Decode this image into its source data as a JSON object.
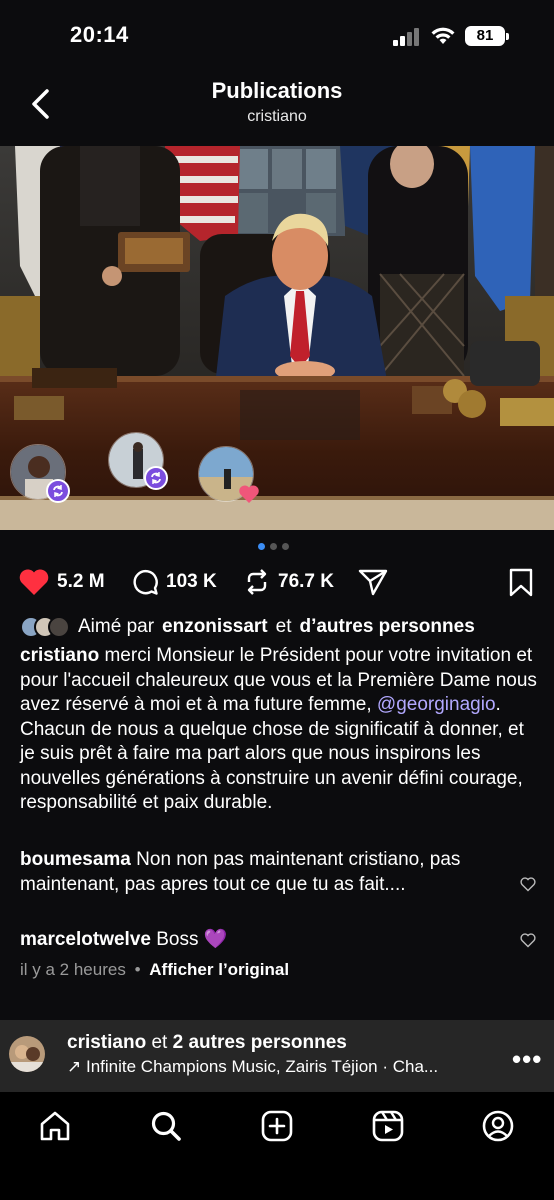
{
  "status_bar": {
    "time": "20:14",
    "battery": "81"
  },
  "header": {
    "title": "Publications",
    "subtitle": "cristiano"
  },
  "post": {
    "carousel_count": 3,
    "carousel_active": 1,
    "likes": "5.2 M",
    "comments": "103 K",
    "reposts": "76.7 K",
    "liked_by_prefix": "Aimé par",
    "liked_by_user": "enzonissart",
    "liked_by_conj": "et",
    "liked_by_rest": "d’autres personnes",
    "caption_user": "cristiano",
    "caption_text_1": " merci Monsieur le Président pour votre invitation et pour l'accueil chaleureux que vous et la Première Dame nous avez réservé à moi et à ma future femme, ",
    "caption_mention": "@georginagio",
    "caption_text_2": ". Chacun de nous a quelque chose de significatif à donner, et je suis prêt à faire ma part alors que nous inspirons les nouvelles générations à construire un avenir défini courage, responsabilité et paix durable.",
    "comments_list": [
      {
        "user": "boumesama",
        "text": " Non non pas maintenant cristiano, pas maintenant, pas apres tout ce que tu as fait...."
      },
      {
        "user": "marcelotwelve",
        "text": " Boss 💜"
      }
    ],
    "time_ago": "il y a 2 heures",
    "separator": "•",
    "translate_link": "Afficher l’original"
  },
  "music": {
    "user": "cristiano",
    "conj": "et",
    "others": "2 autres personnes",
    "arrow": "↗",
    "track": "Infinite Champions Music, Zairis Téjion · Cha...",
    "more": "•••"
  },
  "colors": {
    "like_red": "#ff3040",
    "mention": "#b2a8ff",
    "badge_purple": "#7b4dde"
  }
}
